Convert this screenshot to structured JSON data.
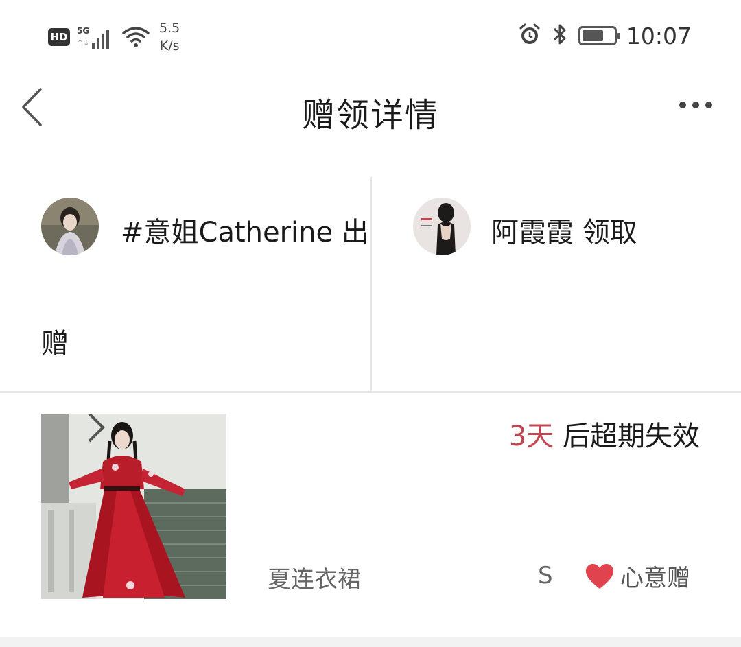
{
  "status_bar": {
    "hd": "HD",
    "network": "5G",
    "network_arrows": "↑↓",
    "speed_value": "5.5",
    "speed_unit": "K/s",
    "time": "10:07",
    "battery_level": 0.6,
    "icons": [
      "hd-icon",
      "signal-icon",
      "wifi-icon",
      "alarm-icon",
      "bluetooth-icon",
      "battery-icon"
    ]
  },
  "header": {
    "title": "赠领详情",
    "back_icon": "chevron-left-icon",
    "more_icon": "more-dots-icon"
  },
  "transfer": {
    "giver": {
      "name_line": "#意姐Catherine 出",
      "tail": "赠"
    },
    "receiver": {
      "name_line": "阿霞霞 领取"
    }
  },
  "item": {
    "expiry_days": "3天",
    "expiry_suffix": " 后超期失效",
    "name": "夏连衣裙",
    "size": "S",
    "gift_label": "心意赠",
    "accent_color": "#c0474f",
    "heart_color": "#e0434d"
  }
}
